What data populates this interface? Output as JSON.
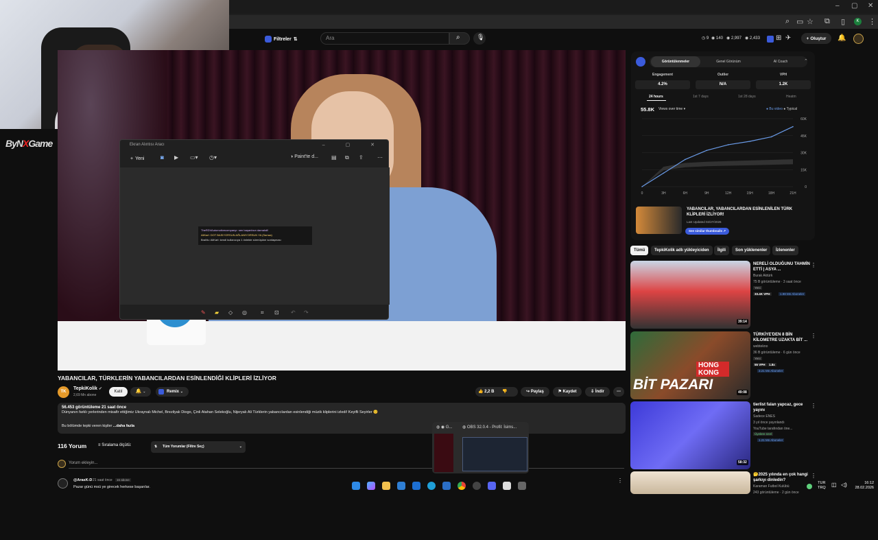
{
  "browser": {
    "window_controls": [
      "–",
      "▢",
      "✕"
    ],
    "toolbar_icons": [
      "zoom-icon",
      "cast-icon",
      "share-icon",
      "star-icon",
      "extensions-icon",
      "split-icon",
      "profile-icon",
      "menu-icon"
    ],
    "profile_initial": "K"
  },
  "overlay": {
    "logo_text_1": "ByN",
    "logo_text_x": "X",
    "logo_text_2": "Game"
  },
  "youtube_header": {
    "filter_label": "Filtreler",
    "search_placeholder": "Ara",
    "stats": [
      "9",
      "140",
      "2,997",
      "2,433"
    ],
    "create_label": "Oluştur"
  },
  "snipping_tool": {
    "title": "Ekran Alıntısı Aracı",
    "new_label": "Yeni",
    "paint_label": "Paint'te d...",
    "chat_lines": [
      "TheRDVAutomotivecompanyr: sen başarılısın damalıdl!",
      "AliKarl: DOT BASIYORSUN AĞLANIYORSUN YA (Sarraa)",
      "BraMu: AliKarl: kendi kullanıcıya 1 önlekte sürmüşüne sonlaşması"
    ]
  },
  "video": {
    "title": "YABANCILAR, TÜRKLERİN YABANCILARDAN ESİNLENDİĞİ KLİPLERİ İZLİYOR",
    "mug_logo": "TK",
    "channel_name": "TepkiKolik",
    "channel_avatar": "TK",
    "channel_subs": "2,69 Mn abone",
    "join_label": "Katıl",
    "remix_label": "Remix",
    "likes": "2,2 B",
    "share_label": "Paylaş",
    "save_label": "Kaydet",
    "download_label": "İndir",
    "views_meta": "56.453 görüntüleme  21 saat önce",
    "description": "Dünyanın farklı yerlerinden misafir ettiğimiz Ukraynalı Michel, Brezilyalı Diogo, Çinli Atahan Selekoğlu, Nijeryalı Ali Türklerin yabancılardan esinlendiği müzik kliplerini izledi! Keyifli Seyirler 😊",
    "desc_more_prefix": "Bu bölümde tepki veren kişiler",
    "desc_more_link": "...daha fazla"
  },
  "comments": {
    "count_label": "116 Yorum",
    "sort_label": "Sıralama ölçütü:",
    "filter_label": "Tüm Yorumlar (Filtre Seç)",
    "input_placeholder": "Yorum ekleyin...",
    "first": {
      "author": "@ArasK-D",
      "time": "21 saat önce",
      "badge": "16 abone",
      "text": "Pazar günü msü ye girecek herkese başarılar."
    }
  },
  "analytics": {
    "tabs": [
      "Görüntülenmeler",
      "Genel Görünüm",
      "AI Coach"
    ],
    "metrics": [
      {
        "label": "Engagement",
        "value": "4.2%"
      },
      {
        "label": "Outlier",
        "value": "N/A"
      },
      {
        "label": "VPH",
        "value": "1.2K"
      }
    ],
    "ranges": [
      "24 hours",
      "1st 7 days",
      "1st 28 days",
      "Heatm"
    ],
    "views_total": "55.8K",
    "views_select": "Views over time ▾",
    "legend_this": "● Bu video",
    "legend_typical": "● Typical",
    "related_title": "YABANCILAR, YABANCILARDAN ESİNLENİLEN TÜRK KLİPLERİ İZLİYOR!",
    "related_updated": "Last Updated 02/27/2026",
    "related_button": "See similar thumbnails ↗"
  },
  "chart_data": {
    "type": "area",
    "x_ticks": [
      "0",
      "3H",
      "6H",
      "9H",
      "12H",
      "15H",
      "18H",
      "21H"
    ],
    "y_ticks": [
      "60K",
      "45K",
      "30K",
      "15K",
      "0"
    ],
    "ylim": [
      0,
      60000
    ],
    "series": [
      {
        "name": "Bu video",
        "x": [
          0,
          3,
          6,
          9,
          12,
          15,
          18,
          21
        ],
        "values": [
          0,
          12000,
          24000,
          32000,
          37000,
          40000,
          44000,
          53000
        ]
      },
      {
        "name": "Typical",
        "x": [
          0,
          3,
          6,
          9,
          12,
          15,
          18,
          21
        ],
        "values": [
          0,
          16000,
          19000,
          20000,
          20500,
          21000,
          21500,
          22000
        ]
      }
    ]
  },
  "chips": [
    "Tümü",
    "TepkiKolik adlı yükleyiciden",
    "İlgili",
    "Son yüklenenler",
    "İzlenenler"
  ],
  "recommended": [
    {
      "title": "NERELİ OLDUĞUNU TAHMİN ETTİ | ASYA ...",
      "channel": "Burak Aktürk",
      "line": "75 B görüntüleme · 3 saat önce",
      "tag": "Yeni",
      "stat": "33.4K VPH",
      "subs": "1.98 Mn Aboneler",
      "duration": "39:14"
    },
    {
      "title": "TÜRKİYE'DEN 8 BİN KİLOMETRE UZAKTA BİT ...",
      "channel": "webtekno",
      "line": "36 B görüntüleme · 6 gün önce",
      "tag": "Yeni",
      "stat": "55 VPH",
      "stat2": "1.8x",
      "subs": "3.21 Mn Aboneler",
      "duration": "49:08",
      "thumb_text_1": "HONG KONG",
      "thumb_text_2": "BİT PAZARI"
    },
    {
      "title": "tierlist falan yapcaz, gece yayını",
      "channel": "Sadece ENES",
      "line": "3 yıl önce yayınlandı",
      "line2": "YouTube tarafından öne...",
      "tag": "Üyelere özel",
      "subs": "1.21 Mn Aboneler",
      "duration": "58:32"
    },
    {
      "title": "🤔2025 yılında en çok hangi şarkıyı dinledin?",
      "channel": "Karaman Futbol Kulübü",
      "line": "243 görüntüleme · 2 gün önce"
    }
  ],
  "taskbar": {
    "preview_1": "G...",
    "preview_2": "OBS 32.0.4 - Profil: İsims...",
    "lang_1": "TUR",
    "lang_2": "TRQ",
    "time": "16:12",
    "date": "28.02.2026"
  }
}
